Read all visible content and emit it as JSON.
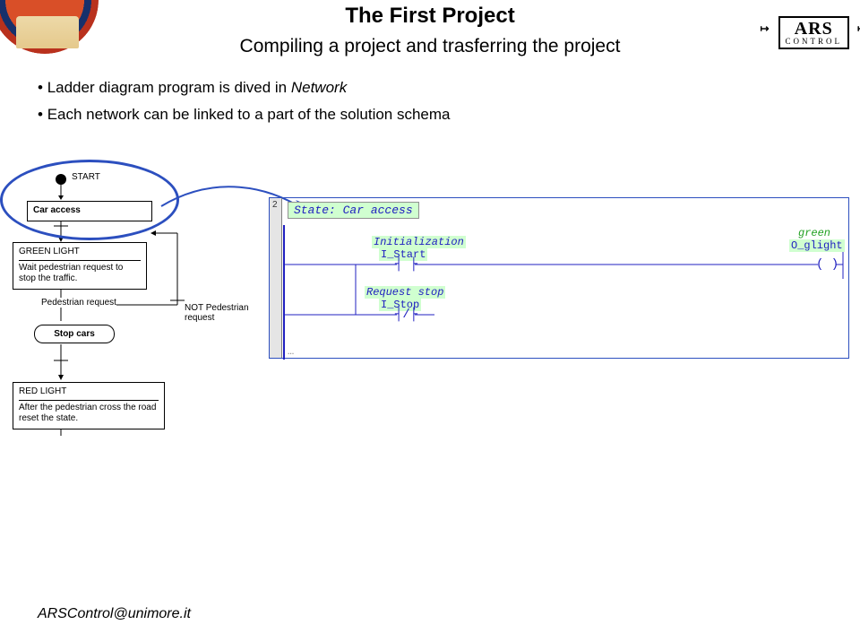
{
  "header": {
    "title": "The First Project",
    "subtitle": "Compiling a project  and trasferring the project",
    "logo_top": "ARS",
    "logo_bottom": "CONTROL"
  },
  "bullets": {
    "b1_pre": "Ladder diagram program is dived in ",
    "b1_em": "Network",
    "b2": "Each network can be linked to a part of the solution schema"
  },
  "flowchart": {
    "start": "START",
    "car_access": "Car access",
    "green_light_title": "GREEN LIGHT",
    "green_light_desc": "Wait pedestrian request to stop the traffic.",
    "ped_req": "Pedestrian request",
    "not_ped_req": "NOT Pedestrian request",
    "stop_cars": "Stop cars",
    "red_light_title": "RED LIGHT",
    "red_light_desc": "After the pedestrian cross the road reset the state."
  },
  "ladder": {
    "network_num": "2",
    "state_label": "State: Car access",
    "init_label": "Initialization",
    "i_start": "I_Start",
    "req_stop": "Request stop",
    "i_stop": "I_Stop",
    "green_comment": "green",
    "output": "O_glight",
    "contact_open": "┤ ├",
    "contact_nc": "┤/├",
    "coil": "( )",
    "ellipsis": "…"
  },
  "footer": {
    "email": "ARSControl@unimore.it"
  }
}
